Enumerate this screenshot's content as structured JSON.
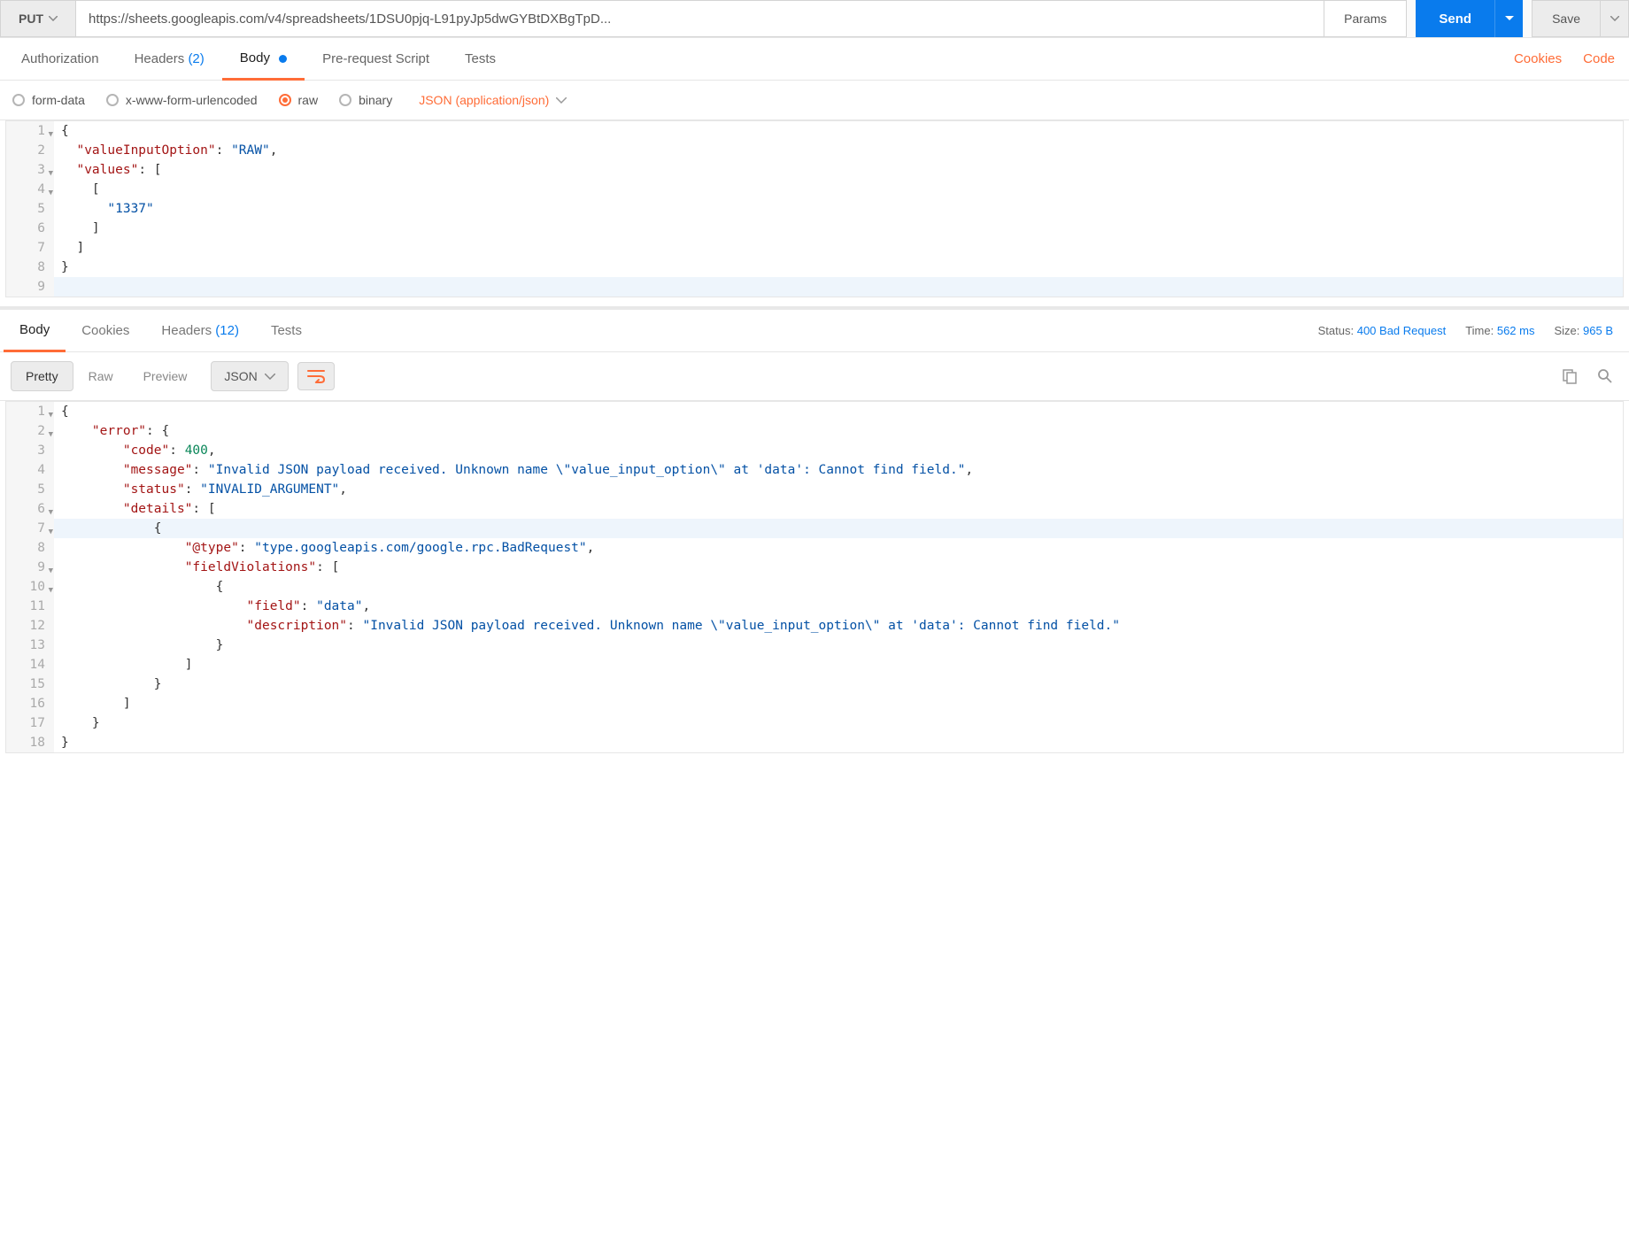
{
  "request": {
    "method": "PUT",
    "url": "https://sheets.googleapis.com/v4/spreadsheets/1DSU0pjq-L91pyJp5dwGYBtDXBgTpD...",
    "params_btn": "Params",
    "send_btn": "Send",
    "save_btn": "Save"
  },
  "req_tabs": {
    "authorization": "Authorization",
    "headers": "Headers",
    "headers_count": "(2)",
    "body": "Body",
    "prerequest": "Pre-request Script",
    "tests": "Tests",
    "cookies_link": "Cookies",
    "code_link": "Code"
  },
  "body_types": {
    "form_data": "form-data",
    "urlencoded": "x-www-form-urlencoded",
    "raw": "raw",
    "binary": "binary",
    "content_type": "JSON (application/json)"
  },
  "request_body_lines": [
    {
      "n": "1",
      "fold": true,
      "html": "<span class='tok-punc'>{</span>"
    },
    {
      "n": "2",
      "html": "  <span class='tok-key'>\"valueInputOption\"</span><span class='tok-punc'>:</span> <span class='tok-str'>\"RAW\"</span><span class='tok-punc'>,</span>"
    },
    {
      "n": "3",
      "fold": true,
      "html": "  <span class='tok-key'>\"values\"</span><span class='tok-punc'>:</span> <span class='tok-punc'>[</span>"
    },
    {
      "n": "4",
      "fold": true,
      "html": "    <span class='tok-punc'>[</span>"
    },
    {
      "n": "5",
      "html": "      <span class='tok-str'>\"1337\"</span>"
    },
    {
      "n": "6",
      "html": "    <span class='tok-punc'>]</span>"
    },
    {
      "n": "7",
      "html": "  <span class='tok-punc'>]</span>"
    },
    {
      "n": "8",
      "html": "<span class='tok-punc'>}</span>"
    },
    {
      "n": "9",
      "cursor": true,
      "html": ""
    }
  ],
  "resp_tabs": {
    "body": "Body",
    "cookies": "Cookies",
    "headers": "Headers",
    "headers_count": "(12)",
    "tests": "Tests"
  },
  "resp_meta": {
    "status_label": "Status:",
    "status_value": "400 Bad Request",
    "time_label": "Time:",
    "time_value": "562 ms",
    "size_label": "Size:",
    "size_value": "965 B"
  },
  "resp_tools": {
    "pretty": "Pretty",
    "raw": "Raw",
    "preview": "Preview",
    "format": "JSON"
  },
  "response_body_lines": [
    {
      "n": "1",
      "fold": true,
      "html": "<span class='tok-punc'>{</span>"
    },
    {
      "n": "2",
      "fold": true,
      "html": "    <span class='tok-key'>\"error\"</span><span class='tok-punc'>:</span> <span class='tok-punc'>{</span>"
    },
    {
      "n": "3",
      "html": "        <span class='tok-key'>\"code\"</span><span class='tok-punc'>:</span> <span class='tok-num'>400</span><span class='tok-punc'>,</span>"
    },
    {
      "n": "4",
      "html": "        <span class='tok-key'>\"message\"</span><span class='tok-punc'>:</span> <span class='tok-str'>\"Invalid JSON payload received. Unknown name \\\"value_input_option\\\" at 'data': Cannot find field.\"</span><span class='tok-punc'>,</span>"
    },
    {
      "n": "5",
      "html": "        <span class='tok-key'>\"status\"</span><span class='tok-punc'>:</span> <span class='tok-str'>\"INVALID_ARGUMENT\"</span><span class='tok-punc'>,</span>"
    },
    {
      "n": "6",
      "fold": true,
      "html": "        <span class='tok-key'>\"details\"</span><span class='tok-punc'>:</span> <span class='tok-punc'>[</span>"
    },
    {
      "n": "7",
      "fold": true,
      "cursor": true,
      "html": "            <span class='tok-punc'>{</span>"
    },
    {
      "n": "8",
      "html": "                <span class='tok-key'>\"@type\"</span><span class='tok-punc'>:</span> <span class='tok-str'>\"type.googleapis.com/google.rpc.BadRequest\"</span><span class='tok-punc'>,</span>"
    },
    {
      "n": "9",
      "fold": true,
      "html": "                <span class='tok-key'>\"fieldViolations\"</span><span class='tok-punc'>:</span> <span class='tok-punc'>[</span>"
    },
    {
      "n": "10",
      "fold": true,
      "html": "                    <span class='tok-punc'>{</span>"
    },
    {
      "n": "11",
      "html": "                        <span class='tok-key'>\"field\"</span><span class='tok-punc'>:</span> <span class='tok-str'>\"data\"</span><span class='tok-punc'>,</span>"
    },
    {
      "n": "12",
      "html": "                        <span class='tok-key'>\"description\"</span><span class='tok-punc'>:</span> <span class='tok-str'>\"Invalid JSON payload received. Unknown name \\\"value_input_option\\\" at 'data': Cannot find field.\"</span>"
    },
    {
      "n": "13",
      "html": "                    <span class='tok-punc'>}</span>"
    },
    {
      "n": "14",
      "html": "                <span class='tok-punc'>]</span>"
    },
    {
      "n": "15",
      "html": "            <span class='tok-punc'>}</span>"
    },
    {
      "n": "16",
      "html": "        <span class='tok-punc'>]</span>"
    },
    {
      "n": "17",
      "html": "    <span class='tok-punc'>}</span>"
    },
    {
      "n": "18",
      "html": "<span class='tok-punc'>}</span>"
    }
  ]
}
